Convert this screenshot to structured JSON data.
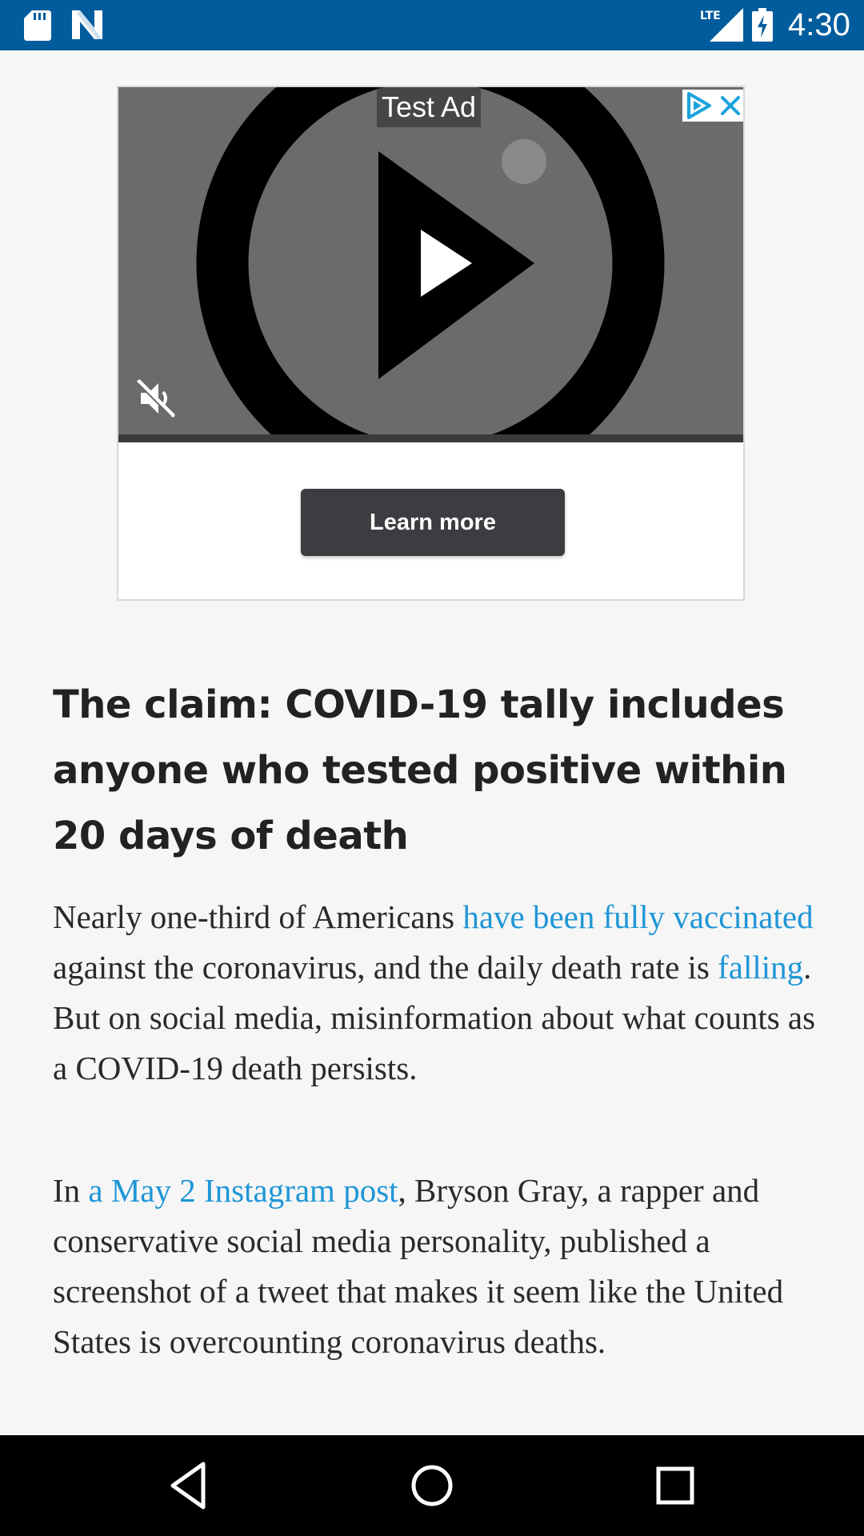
{
  "status_bar": {
    "time": "4:30",
    "network": "LTE",
    "icons": [
      "sd-card-icon",
      "n-app-icon",
      "lte-signal-icon",
      "battery-charging-icon"
    ]
  },
  "ad": {
    "label": "Test Ad",
    "cta_label": "Learn more",
    "icons": [
      "adchoices-icon",
      "close-icon",
      "play-icon",
      "mute-icon"
    ]
  },
  "article": {
    "headline": "The claim: COVID-19 tally includes anyone who tested positive within 20 days of death",
    "para1": {
      "t1": "Nearly one-third of Americans ",
      "link1": "have been fully vaccinated",
      "t2": " against the coronavirus, and the daily death rate is ",
      "link2": "falling",
      "t3": ". But on social media, misinformation about what counts as a COVID-19 death persists."
    },
    "para2": {
      "t1": "In ",
      "link1": "a May 2 Instagram post",
      "t2": ", Bryson Gray, a rapper and conservative social media personality, published a screenshot of a tweet that makes it seem like the United States is overcounting coronavirus deaths."
    }
  },
  "nav_bar": {
    "icons": [
      "back-icon",
      "home-icon",
      "recents-icon"
    ]
  },
  "colors": {
    "status_bar_bg": "#005c9c",
    "link": "#1f96d6",
    "cta_bg": "#3d3c40",
    "page_bg": "#f6f6f6"
  }
}
